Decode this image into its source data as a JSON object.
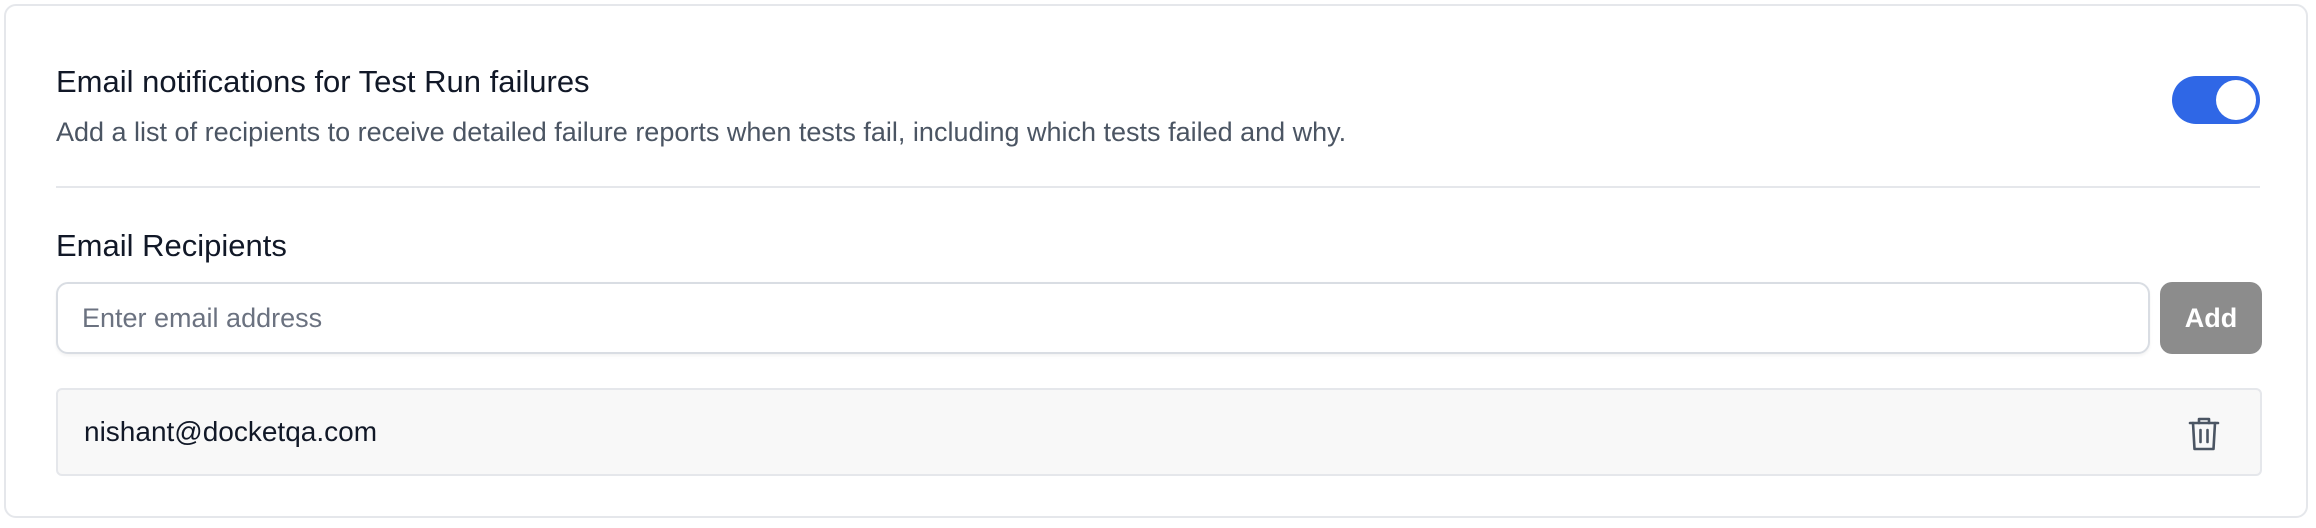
{
  "notifications": {
    "title": "Email notifications for Test Run failures",
    "description": "Add a list of recipients to receive detailed failure reports when tests fail, including which tests failed and why.",
    "enabled": true,
    "toggle_color": "#2f67e6"
  },
  "recipients": {
    "section_title": "Email Recipients",
    "input": {
      "placeholder": "Enter email address",
      "value": ""
    },
    "add_label": "Add",
    "add_button_color": "#8c8c8c",
    "list": [
      {
        "email": "nishant@docketqa.com",
        "delete_icon": "trash-icon"
      }
    ]
  }
}
